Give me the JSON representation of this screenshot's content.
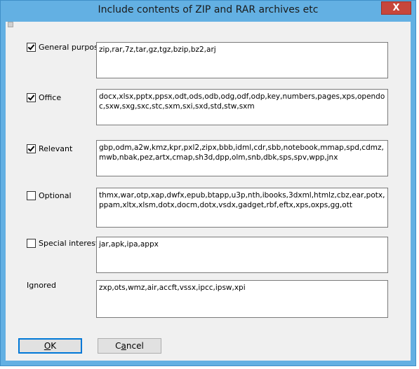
{
  "window": {
    "title": "Include contents of ZIP and RAR archives etc",
    "close_label": "X"
  },
  "groups": [
    {
      "label": "General purpose",
      "checked": true,
      "extensions": "zip,rar,7z,tar,gz,tgz,bzip,bz2,arj"
    },
    {
      "label": "Office",
      "checked": true,
      "extensions": "docx,xlsx,pptx,ppsx,odt,ods,odb,odg,odf,odp,key,numbers,pages,xps,opendoc,sxw,sxg,sxc,stc,sxm,sxi,sxd,std,stw,sxm"
    },
    {
      "label": "Relevant",
      "checked": true,
      "extensions": "gbp,odm,a2w,kmz,kpr,pxl2,zipx,bbb,idml,cdr,sbb,notebook,mmap,spd,cdmz,mwb,nbak,pez,artx,cmap,sh3d,dpp,olm,snb,dbk,sps,spv,wpp,jnx"
    },
    {
      "label": "Optional",
      "checked": false,
      "extensions": "thmx,war,otp,xap,dwfx,epub,btapp,u3p,nth,ibooks,3dxml,htmlz,cbz,ear,potx,ppam,xltx,xlsm,dotx,docm,dotx,vsdx,gadget,rbf,eftx,xps,oxps,gg,ott"
    },
    {
      "label": "Special interest",
      "checked": false,
      "extensions": "jar,apk,ipa,appx"
    }
  ],
  "ignored": {
    "label": "Ignored",
    "extensions": "zxp,ots,wmz,air,accft,vssx,ipcc,ipsw,xpi"
  },
  "buttons": {
    "ok_accel": "O",
    "ok_rest": "K",
    "cancel_pre": "C",
    "cancel_accel": "a",
    "cancel_rest": "ncel"
  }
}
